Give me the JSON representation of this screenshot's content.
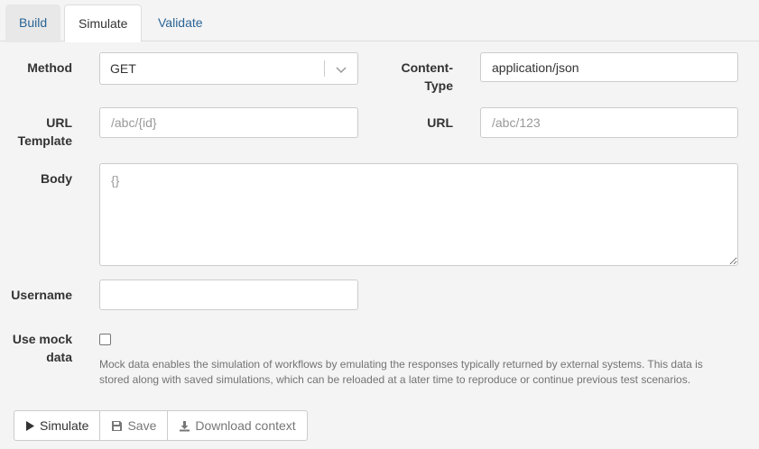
{
  "tabs": [
    {
      "label": "Build"
    },
    {
      "label": "Simulate"
    },
    {
      "label": "Validate"
    }
  ],
  "form": {
    "method": {
      "label": "Method",
      "value": "GET"
    },
    "content_type": {
      "label_line1": "Content-",
      "label_line2": "Type",
      "value": "application/json"
    },
    "url_template": {
      "label_line1": "URL",
      "label_line2": "Template",
      "placeholder": "/abc/{id}"
    },
    "url": {
      "label": "URL",
      "placeholder": "/abc/123"
    },
    "body": {
      "label": "Body",
      "placeholder": "{}"
    },
    "username": {
      "label": "Username",
      "value": ""
    },
    "use_mock": {
      "label_line1": "Use mock",
      "label_line2": "data",
      "checked": false,
      "help": "Mock data enables the simulation of workflows by emulating the responses typically returned by external systems. This data is stored along with saved simulations, which can be reloaded at a later time to reproduce or continue previous test scenarios."
    }
  },
  "actions": {
    "simulate": "Simulate",
    "save": "Save",
    "download": "Download context"
  },
  "icons": {
    "play": "play-icon",
    "save": "floppy-icon",
    "download": "download-icon",
    "chevron": "chevron-down-icon"
  }
}
